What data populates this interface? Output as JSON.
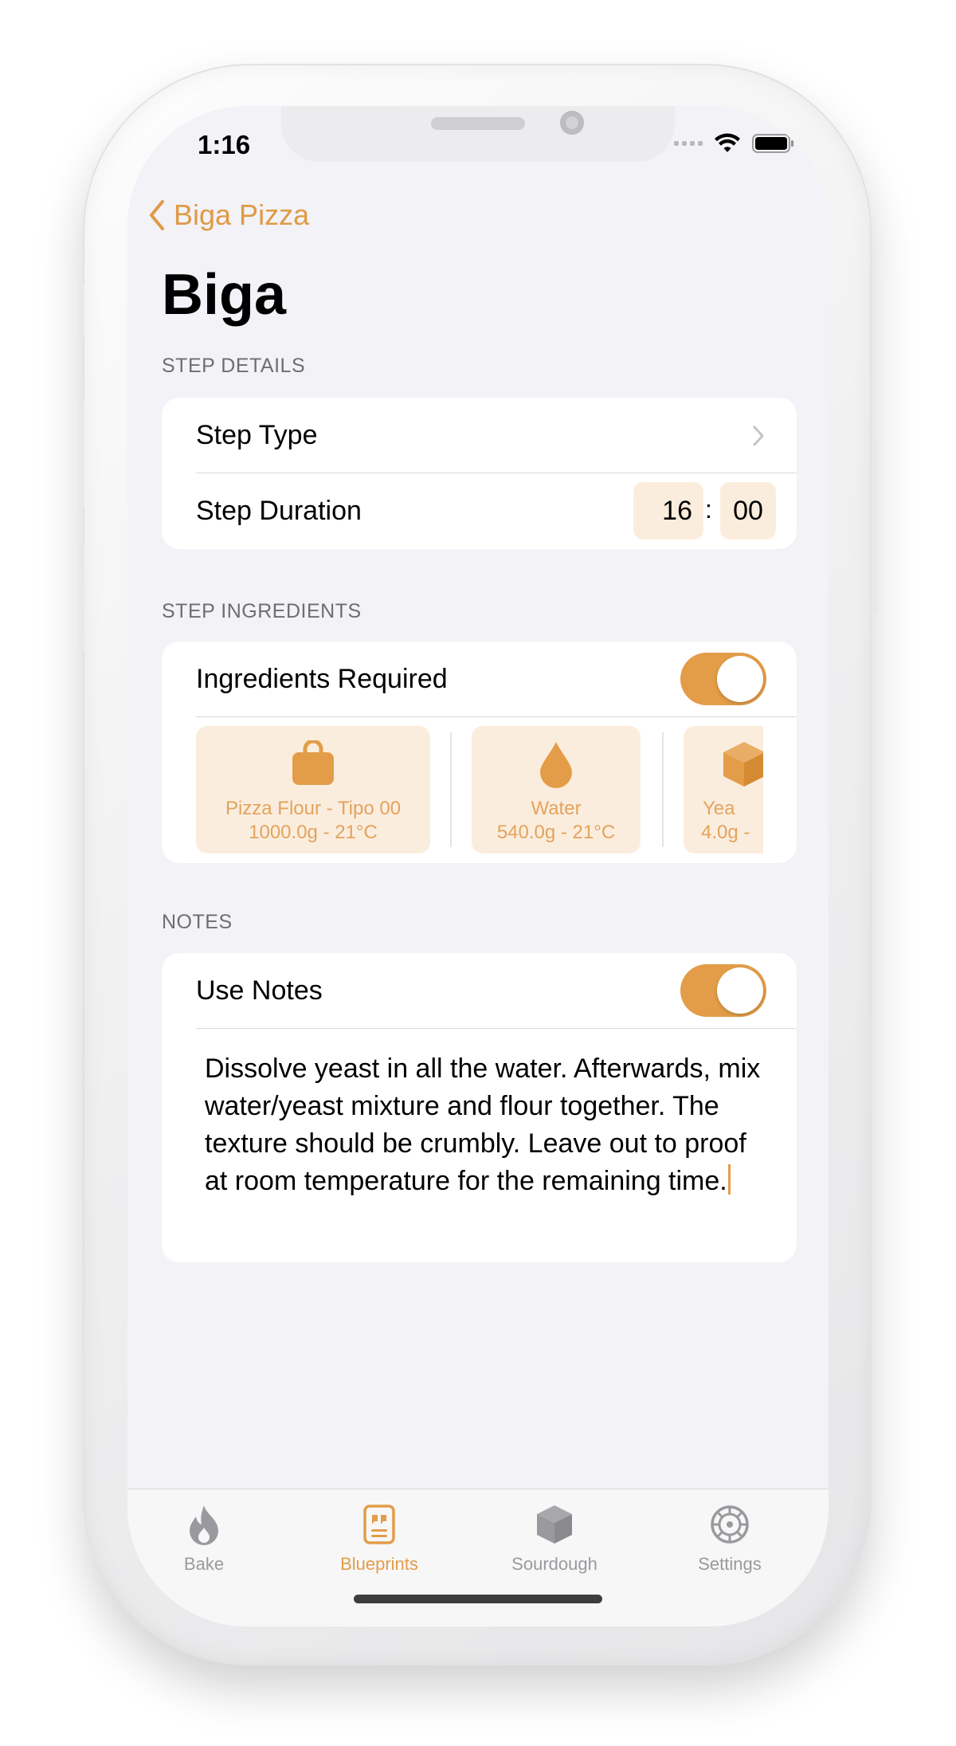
{
  "status_bar": {
    "time": "1:16"
  },
  "nav": {
    "back_label": "Biga Pizza",
    "title": "Biga"
  },
  "step_details": {
    "header": "STEP DETAILS",
    "step_type_label": "Step Type",
    "step_duration_label": "Step Duration",
    "duration_hours": "16",
    "duration_separator": ":",
    "duration_minutes": "00"
  },
  "step_ingredients": {
    "header": "STEP INGREDIENTS",
    "toggle_label": "Ingredients Required",
    "toggle_on": true,
    "items": [
      {
        "name": "Pizza Flour - Tipo 00",
        "amount": "1000.0g - 21°C",
        "icon": "bag-icon"
      },
      {
        "name": "Water",
        "amount": "540.0g - 21°C",
        "icon": "water-drop-icon"
      },
      {
        "name": "Yea",
        "amount": "4.0g -",
        "icon": "box-icon"
      }
    ]
  },
  "notes": {
    "header": "NOTES",
    "toggle_label": "Use Notes",
    "toggle_on": true,
    "text": "Dissolve yeast in all the water. Afterwards, mix water/yeast mixture and flour together. The texture should be crumbly. Leave out to proof at room temperature for the remaining time."
  },
  "tabbar": {
    "tabs": [
      {
        "label": "Bake",
        "icon": "flame-icon",
        "active": false
      },
      {
        "label": "Blueprints",
        "icon": "recipe-card-icon",
        "active": true
      },
      {
        "label": "Sourdough",
        "icon": "box-icon",
        "active": false
      },
      {
        "label": "Settings",
        "icon": "gear-icon",
        "active": false
      }
    ]
  },
  "colors": {
    "accent": "#E39D48",
    "tile_background": "#FBEDDD",
    "screen_background": "#F2F2F7",
    "inactive_tab": "#9A9A9E"
  }
}
